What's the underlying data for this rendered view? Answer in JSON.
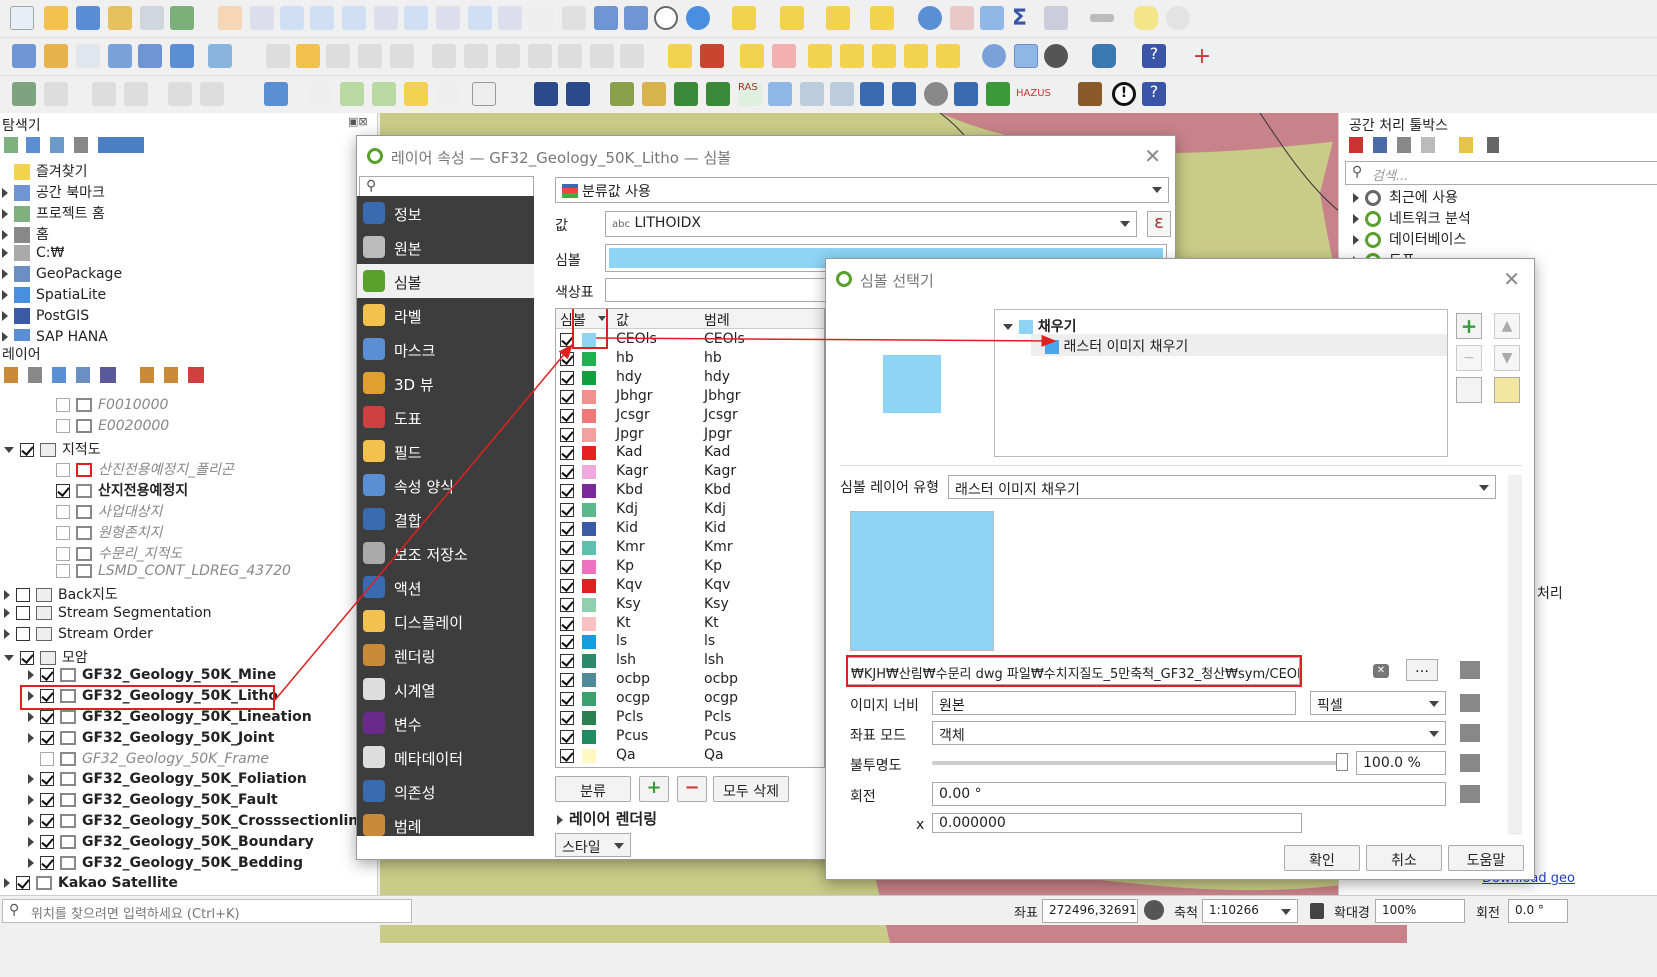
{
  "colors": {
    "accent": "#e02020",
    "swatch": "#8dd4f5",
    "nav_bg": "#3d3d3d",
    "map_base": "#c9cc88",
    "map_red": "#c8838a"
  },
  "browser": {
    "title": "탐색기",
    "items": [
      "즐겨찾기",
      "공간 북마크",
      "프로젝트 홈",
      "홈",
      "C:₩",
      "GeoPackage",
      "SpatiaLite",
      "PostGIS",
      "SAP HANA"
    ]
  },
  "layers": {
    "title": "레이어",
    "items": [
      {
        "label": "F0010000",
        "style": "dim",
        "checked": false,
        "indent": 2
      },
      {
        "label": "E0020000",
        "style": "dim",
        "checked": false,
        "indent": 2
      },
      {
        "label": "지적도",
        "style": "group",
        "checked": true,
        "indent": 0
      },
      {
        "label": "산진전용예정지_폴리곤",
        "style": "dim",
        "checked": false,
        "indent": 2
      },
      {
        "label": "산지전용예정지",
        "style": "bold",
        "checked": true,
        "indent": 2
      },
      {
        "label": "사업대상지",
        "style": "dim",
        "checked": false,
        "indent": 2
      },
      {
        "label": "원형존치지",
        "style": "dim",
        "checked": false,
        "indent": 2
      },
      {
        "label": "수문리_지적도",
        "style": "dim",
        "checked": false,
        "indent": 2
      },
      {
        "label": "LSMD_CONT_LDREG_43720",
        "style": "dim",
        "checked": false,
        "indent": 2
      },
      {
        "label": "Back지도",
        "style": "group",
        "checked": false,
        "indent": 0
      },
      {
        "label": "Stream Segmentation",
        "style": "group",
        "checked": false,
        "indent": 0
      },
      {
        "label": "Stream Order",
        "style": "group",
        "checked": false,
        "indent": 0
      },
      {
        "label": "모암",
        "style": "group",
        "checked": true,
        "indent": 0
      },
      {
        "label": "GF32_Geology_50K_Mine",
        "style": "bold",
        "checked": true,
        "indent": 1
      },
      {
        "label": "GF32_Geology_50K_Litho",
        "style": "bold",
        "checked": true,
        "indent": 1
      },
      {
        "label": "GF32_Geology_50K_Lineation",
        "style": "bold",
        "checked": true,
        "indent": 1
      },
      {
        "label": "GF32_Geology_50K_Joint",
        "style": "bold",
        "checked": true,
        "indent": 1
      },
      {
        "label": "GF32_Geology_50K_Frame",
        "style": "dim",
        "checked": false,
        "indent": 1
      },
      {
        "label": "GF32_Geology_50K_Foliation",
        "style": "bold",
        "checked": true,
        "indent": 1
      },
      {
        "label": "GF32_Geology_50K_Fault",
        "style": "bold",
        "checked": true,
        "indent": 1
      },
      {
        "label": "GF32_Geology_50K_Crosssectionline",
        "style": "bold",
        "checked": true,
        "indent": 1
      },
      {
        "label": "GF32_Geology_50K_Boundary",
        "style": "bold",
        "checked": true,
        "indent": 1
      },
      {
        "label": "GF32_Geology_50K_Bedding",
        "style": "bold",
        "checked": true,
        "indent": 1
      },
      {
        "label": "Kakao Satellite",
        "style": "bold",
        "checked": true,
        "indent": 0
      }
    ]
  },
  "props_dialog": {
    "title": "레이어 속성 — GF32_Geology_50K_Litho — 심볼",
    "nav": [
      "정보",
      "원본",
      "심볼",
      "라벨",
      "마스크",
      "3D 뷰",
      "도표",
      "필드",
      "속성 양식",
      "결합",
      "보조 저장소",
      "액션",
      "디스플레이",
      "렌더링",
      "시계열",
      "변수",
      "메타데이터",
      "의존성",
      "범례"
    ],
    "renderer": "분류값 사용",
    "value_label": "값",
    "value_field": "LITHOIDX",
    "symbol_label": "심볼",
    "ramp_label": "색상표",
    "col_symbol": "심볼",
    "col_value": "값",
    "col_legend": "범례",
    "classes": [
      {
        "v": "CEOls",
        "c": "#8dd4f5"
      },
      {
        "v": "hb",
        "c": "#20b050"
      },
      {
        "v": "hdy",
        "c": "#10a040"
      },
      {
        "v": "Jbhgr",
        "c": "#f29090"
      },
      {
        "v": "Jcsgr",
        "c": "#f07878"
      },
      {
        "v": "Jpgr",
        "c": "#f4a0a0"
      },
      {
        "v": "Kad",
        "c": "#e82020"
      },
      {
        "v": "Kagr",
        "c": "#f0a8e0"
      },
      {
        "v": "Kbd",
        "c": "#7a2a9a"
      },
      {
        "v": "Kdj",
        "c": "#5ab88c"
      },
      {
        "v": "Kid",
        "c": "#3a5aa8"
      },
      {
        "v": "Kmr",
        "c": "#60c0b0"
      },
      {
        "v": "Kp",
        "c": "#f070c0"
      },
      {
        "v": "Kqv",
        "c": "#e02020"
      },
      {
        "v": "Ksy",
        "c": "#90d0b0"
      },
      {
        "v": "Kt",
        "c": "#f8c0c0"
      },
      {
        "v": "ls",
        "c": "#10a0e0"
      },
      {
        "v": "lsh",
        "c": "#2a8a6a"
      },
      {
        "v": "ocbp",
        "c": "#508a98"
      },
      {
        "v": "ocgp",
        "c": "#3aa070"
      },
      {
        "v": "Pcls",
        "c": "#2a8050"
      },
      {
        "v": "Pcus",
        "c": "#208a60"
      },
      {
        "v": "Qa",
        "c": "#fff8c0"
      }
    ],
    "classify_btn": "분류",
    "delete_all_btn": "모두 삭제",
    "layer_render": "레이어 렌더링",
    "style_btn": "스타일"
  },
  "selector_dialog": {
    "title": "심볼 선택기",
    "tree_root": "채우기",
    "tree_child": "래스터 이미지 채우기",
    "layer_type_label": "심볼 레이어 유형",
    "layer_type": "래스터 이미지 채우기",
    "path": "₩KJH₩산림₩수문리 dwg 파일₩수치지질도_5만축척_GF32_청산₩sym/CEOls.png",
    "width_label": "이미지 너비",
    "width_value": "원본",
    "width_unit": "픽셀",
    "coord_label": "좌표 모드",
    "coord_value": "객체",
    "opacity_label": "불투명도",
    "opacity_value": "100.0 %",
    "rotation_label": "회전",
    "rotation_value": "0.00 °",
    "offset_x_label": "x",
    "offset_x": "0.000000",
    "ok": "확인",
    "cancel": "취소",
    "help": "도움말"
  },
  "toolbox": {
    "title": "공간 처리 툴박스",
    "search_placeholder": "검색...",
    "items": [
      "최근에 사용",
      "네트워크 분석",
      "데이터베이스",
      "도표"
    ],
    "side_text": "처리",
    "link": "Download geo"
  },
  "status": {
    "locator_placeholder": "위치를 찾으려면 입력하세요 (Ctrl+K)",
    "coord_label": "좌표",
    "coord": "272496,326910",
    "scale_label": "축척",
    "scale": "1:10266",
    "mag_label": "확대경",
    "mag": "100%",
    "rot_label": "회전",
    "rot": "0.0 °"
  }
}
